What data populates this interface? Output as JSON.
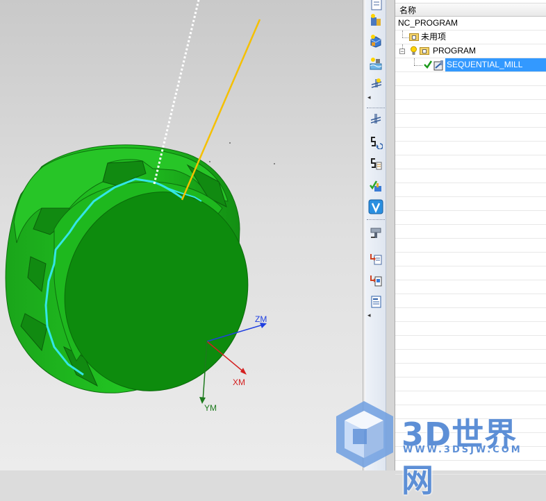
{
  "viewport": {
    "axes": {
      "zm": "ZM",
      "xm": "XM",
      "ym": "YM"
    },
    "part_color": "#1fae1f",
    "tool_axis_color": "#f5c000",
    "toolpath_color": "#33e6e6"
  },
  "toolbar": {
    "buttons": [
      "create-program-icon",
      "create-tool-icon",
      "create-geometry-icon",
      "create-method-icon",
      "create-operation-icon",
      "generate-toolpath-icon",
      "replay-toolpath-icon",
      "list-toolpath-icon",
      "verify-toolpath-icon",
      "vericut-icon",
      "simulate-machine-icon",
      "postprocess-icon",
      "shop-docs-icon",
      "output-report-icon"
    ]
  },
  "navigator": {
    "column_header": "名称",
    "items": [
      {
        "label": "NC_PROGRAM"
      },
      {
        "label": "未用项"
      },
      {
        "label": "PROGRAM"
      },
      {
        "label": "SEQUENTIAL_MILL",
        "selected": true
      }
    ]
  },
  "watermark": {
    "title": "3D世界网",
    "url": "WWW.3DSJW.COM"
  }
}
